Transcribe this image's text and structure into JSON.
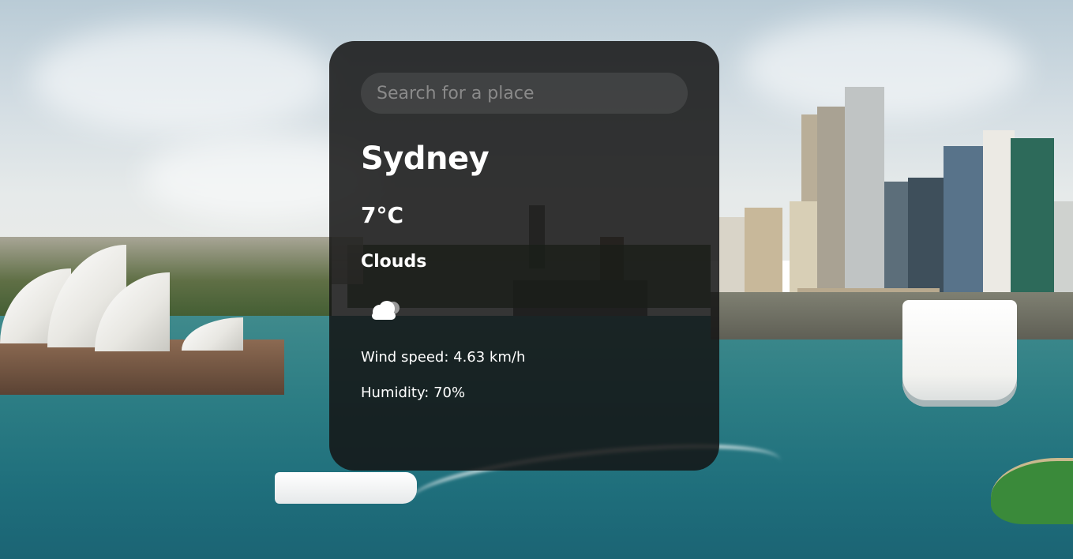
{
  "search": {
    "placeholder": "Search for a place",
    "value": ""
  },
  "weather": {
    "city": "Sydney",
    "temperature": "7°C",
    "description": "Clouds",
    "icon": "clouds-icon",
    "wind_speed": "Wind speed: 4.63 km/h",
    "humidity": "Humidity: 70%"
  },
  "colors": {
    "card_background": "#141414",
    "text": "#ffffff",
    "search_background": "#2e2e2e",
    "placeholder": "#8a8a8a"
  },
  "background": {
    "image_description_icon": "sydney-harbour-background"
  }
}
